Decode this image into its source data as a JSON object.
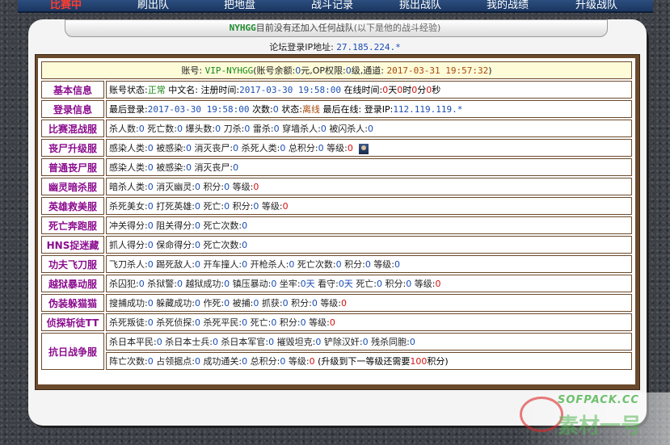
{
  "nav": {
    "items": [
      "比赛中",
      "刷出队",
      "把地盘",
      "战斗记录",
      "挑出战队",
      "我的战绩",
      "升级战队"
    ]
  },
  "notice": {
    "team": "NYHGG",
    "text": "目前没有还加入任何战队",
    "hint": "(以下是他的战斗经验)"
  },
  "ip_line": {
    "label": "论坛登录IP地址:",
    "value": "27.185.224.*"
  },
  "account": {
    "k_account": "账号:",
    "account": "VIP-NYHGG",
    "k_balance": "(账号余额:",
    "balance": "0",
    "u_balance": "元,",
    "k_op": "OP权限:",
    "op": "0",
    "u_op": "级,",
    "k_channel": "通道:",
    "channel": "2017-03-31 19:57:32",
    "end": ")"
  },
  "basic": {
    "label": "基本信息",
    "k_status": "账号状态:",
    "status": "正常",
    "k_cn": "中文名:",
    "k_reg": "注册时间:",
    "reg": "2017-03-30 19:58:00",
    "k_online": "在线时间:",
    "d": "0",
    "u_d": "天",
    "h": "0",
    "u_h": "时",
    "m": "0",
    "u_m": "分",
    "s": "0",
    "u_s": "秒"
  },
  "login": {
    "label": "登录信息",
    "k_last": "最后登录:",
    "last": "2017-03-30 19:58:00",
    "k_times": "次数:",
    "times": "0",
    "k_state": "状态:",
    "state": "离线",
    "k_lastonline": "最后在线:",
    "k_ip": "登录IP:",
    "ip": "112.119.119.*"
  },
  "rows": [
    {
      "label": "比赛混战服",
      "items": [
        [
          "杀人数:",
          "0"
        ],
        [
          "死亡数:",
          "0"
        ],
        [
          "爆头数:",
          "0"
        ],
        [
          "刀杀:",
          "0"
        ],
        [
          "雷杀:",
          "0"
        ],
        [
          "穿墙杀人:",
          "0"
        ],
        [
          "被闪杀人:",
          "0"
        ]
      ]
    },
    {
      "label": "丧尸升级服",
      "items": [
        [
          "感染人类:",
          "0"
        ],
        [
          "被感染:",
          "0"
        ],
        [
          "消灭丧尸:",
          "0"
        ],
        [
          "杀死人类:",
          "0"
        ],
        [
          "总积分:",
          "0"
        ],
        [
          "等级:",
          "0"
        ]
      ],
      "last_red": true,
      "icon": "player-avatar-icon"
    },
    {
      "label": "普通丧尸服",
      "items": [
        [
          "感染人类:",
          "0"
        ],
        [
          "被感染:",
          "0"
        ],
        [
          "消灭丧尸:",
          "0"
        ]
      ]
    },
    {
      "label": "幽灵暗杀服",
      "items": [
        [
          "暗杀人类:",
          "0"
        ],
        [
          "消灭幽灵:",
          "0"
        ],
        [
          "积分:",
          "0"
        ],
        [
          "等级:",
          "0"
        ]
      ],
      "last_red": true
    },
    {
      "label": "英雄救美服",
      "items": [
        [
          "杀死美女:",
          "0"
        ],
        [
          "打死英雄:",
          "0"
        ],
        [
          "死亡:",
          "0"
        ],
        [
          "积分:",
          "0"
        ],
        [
          "等级:",
          "0"
        ]
      ],
      "last_red": true
    },
    {
      "label": "死亡奔跑服",
      "items": [
        [
          "冲关得分:",
          "0"
        ],
        [
          "阻关得分:",
          "0"
        ],
        [
          "死亡次数:",
          "0"
        ]
      ]
    },
    {
      "label": "HNS捉迷藏",
      "items": [
        [
          "抓人得分:",
          "0"
        ],
        [
          "保命得分:",
          "0"
        ],
        [
          "死亡次数:",
          "0"
        ]
      ]
    },
    {
      "label": "功夫飞刀服",
      "items": [
        [
          "飞刀杀人:",
          "0"
        ],
        [
          "踢死敌人:",
          "0"
        ],
        [
          "开车撞人:",
          "0"
        ],
        [
          "开枪杀人:",
          "0"
        ],
        [
          "死亡次数:",
          "0"
        ],
        [
          "积分:",
          "0"
        ],
        [
          "等级:",
          "0"
        ]
      ]
    },
    {
      "label": "越狱暴动服",
      "items": [
        [
          "杀囚犯:",
          "0"
        ],
        [
          "杀狱警:",
          "0"
        ],
        [
          "越狱成功:",
          "0"
        ],
        [
          "镇压暴动:",
          "0"
        ],
        [
          "坐牢:",
          "0天"
        ],
        [
          "看守:",
          "0天"
        ],
        [
          "死亡:",
          "0"
        ],
        [
          "积分:",
          "0"
        ],
        [
          "等级:",
          "0"
        ]
      ],
      "last_red": true
    },
    {
      "label": "伪装躲猫猫",
      "items": [
        [
          "搜捕成功:",
          "0"
        ],
        [
          "躲藏成功:",
          "0"
        ],
        [
          "作死:",
          "0"
        ],
        [
          "被捕:",
          "0"
        ],
        [
          "抓获:",
          "0"
        ],
        [
          "积分:",
          "0"
        ],
        [
          "等级:",
          "0"
        ]
      ],
      "last_red": true
    },
    {
      "label": "侦探斩徒TT",
      "items": [
        [
          "杀死叛徒:",
          "0"
        ],
        [
          "杀死侦探:",
          "0"
        ],
        [
          "杀死平民:",
          "0"
        ],
        [
          "死亡:",
          "0"
        ],
        [
          "积分:",
          "0"
        ],
        [
          "等级:",
          "0"
        ]
      ],
      "last_red": true
    }
  ],
  "war": {
    "label": "抗日战争服",
    "line1": [
      [
        "杀日本平民:",
        "0"
      ],
      [
        "杀日本士兵:",
        "0"
      ],
      [
        "杀日本军官:",
        "0"
      ],
      [
        "摧毁坦克:",
        "0"
      ],
      [
        "铲除汉奸:",
        "0"
      ],
      [
        "残杀同胞:",
        "0"
      ]
    ],
    "line2": [
      [
        "阵亡次数:",
        "0"
      ],
      [
        "占领据点:",
        "0"
      ],
      [
        "成功通关:",
        "0"
      ],
      [
        "总积分:",
        "0"
      ],
      [
        "等级:",
        "0"
      ]
    ],
    "note_pre": "(升级到下一等级还需要",
    "note_val": "100",
    "note_post": "积分)"
  },
  "watermark": {
    "en": "SOFPACK.CC",
    "cn": "素材一号"
  }
}
